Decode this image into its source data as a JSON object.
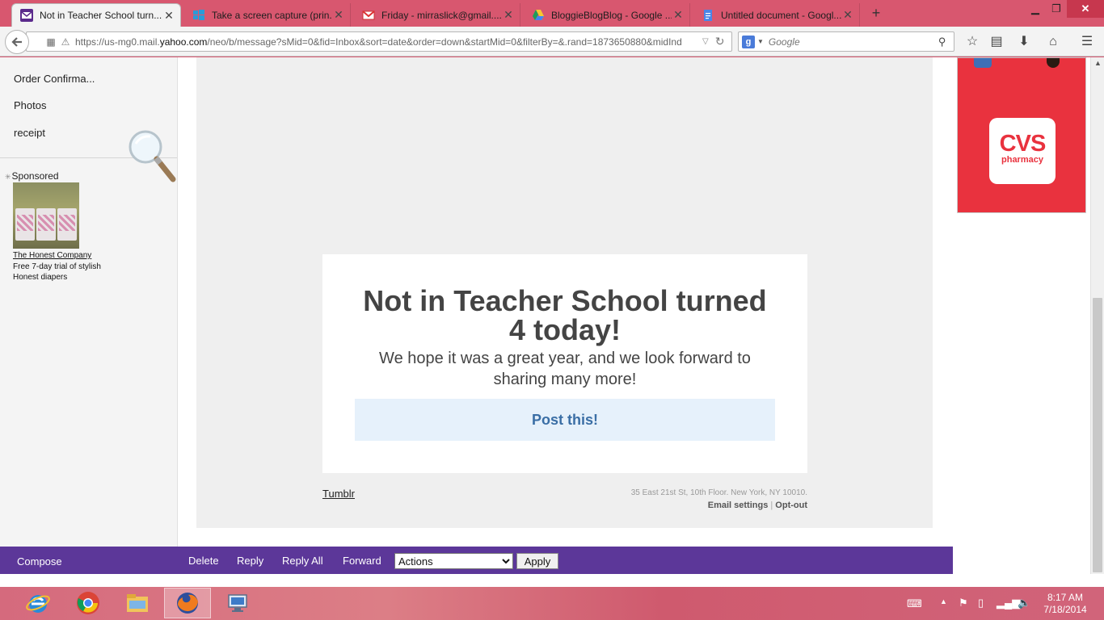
{
  "browser": {
    "tabs": [
      {
        "label": "Not in Teacher School turn...",
        "active": true
      },
      {
        "label": "Take a screen capture (prin...",
        "active": false
      },
      {
        "label": "Friday - mirraslick@gmail....",
        "active": false
      },
      {
        "label": "BloggieBlogBlog - Google ...",
        "active": false
      },
      {
        "label": "Untitled document - Googl...",
        "active": false
      }
    ],
    "new_tab": "+",
    "url_prefix": "https://us-mg0.mail.",
    "url_domain": "yahoo.com",
    "url_rest": "/neo/b/message?sMid=0&fid=Inbox&sort=date&order=down&startMid=0&filterBy=&.rand=1873650880&midInd",
    "search_placeholder": "Google",
    "search_engine_letter": "g"
  },
  "sidebar": {
    "folders": [
      "Order Confirma...",
      "Photos",
      "receipt"
    ],
    "sponsored_label": "Sponsored",
    "ad_title": "The Honest Company",
    "ad_desc": "Free 7-day trial of stylish Honest diapers"
  },
  "message": {
    "title": "Not in Teacher School turned 4 today!",
    "subtitle": "We hope it was a great year, and we look forward to sharing many more!",
    "button": "Post this!",
    "footer_link": "Tumblr",
    "address": "35 East 21st St, 10th Floor. New York, NY 10010.",
    "email_settings": "Email settings",
    "separator": "|",
    "opt_out": "Opt-out"
  },
  "right_ad": {
    "brand": "CVS",
    "sub": "pharmacy"
  },
  "actionbar": {
    "compose": "Compose",
    "delete": "Delete",
    "reply": "Reply",
    "reply_all": "Reply All",
    "forward": "Forward",
    "actions_selected": "Actions",
    "apply": "Apply"
  },
  "taskbar": {
    "time": "8:17 AM",
    "date": "7/18/2014",
    "apps": [
      "internet-explorer-icon",
      "chrome-icon",
      "file-explorer-icon",
      "firefox-icon",
      "remote-desktop-icon"
    ]
  },
  "colors": {
    "accent_purple": "#5c3799",
    "button_bg": "#e6f1fb",
    "button_text": "#3a6ea5",
    "cvs_red": "#e9323e",
    "tabbar": "#d8576f"
  }
}
